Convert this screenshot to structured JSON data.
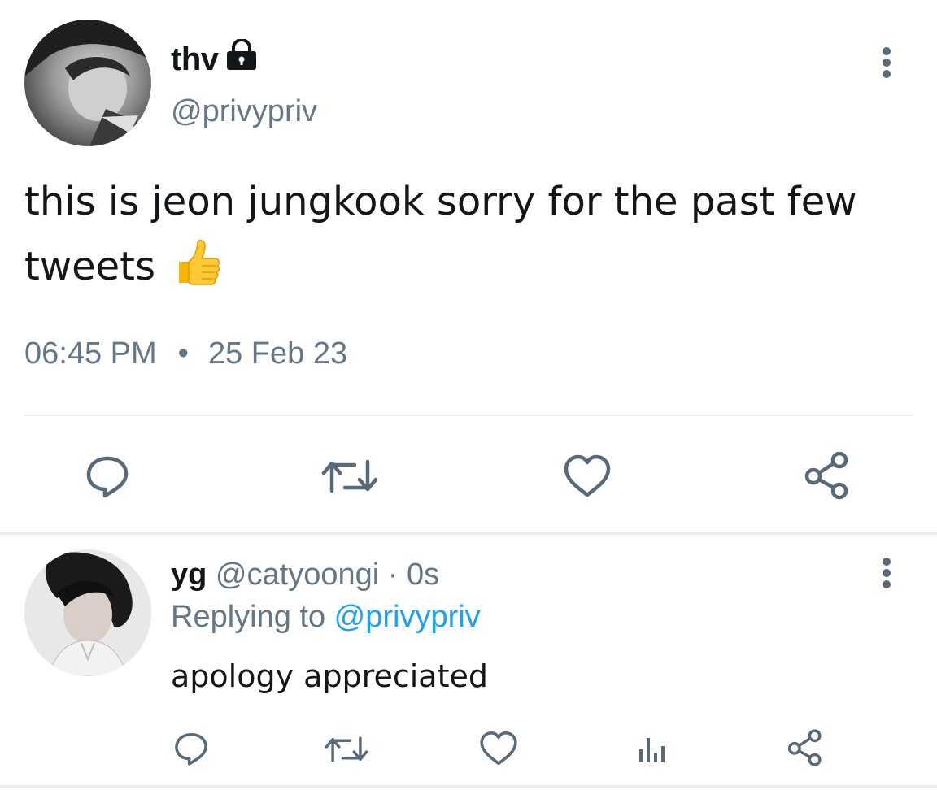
{
  "main_tweet": {
    "display_name": "thv",
    "handle": "@privypriv",
    "protected": true,
    "text": "this is jeon jungkook sorry for the past few tweets",
    "emoji": "thumbs-up",
    "time": "06:45 PM",
    "separator": "•",
    "date": "25 Feb 23",
    "actions": [
      "reply-icon",
      "retweet-icon",
      "like-icon",
      "share-icon"
    ]
  },
  "reply": {
    "display_name": "yg",
    "handle": "@catyoongi",
    "time_sep": " · ",
    "age": "0s",
    "replying_prefix": "Replying to ",
    "replying_to": "@privypriv",
    "text": "apology appreciated",
    "actions": [
      "reply-icon",
      "retweet-icon",
      "like-icon",
      "analytics-icon",
      "share-icon"
    ]
  },
  "colors": {
    "text_primary": "#14171a",
    "text_secondary": "#657786",
    "link": "#1da1f2",
    "icon": "#586a7a",
    "divider": "#e6ecf0"
  }
}
